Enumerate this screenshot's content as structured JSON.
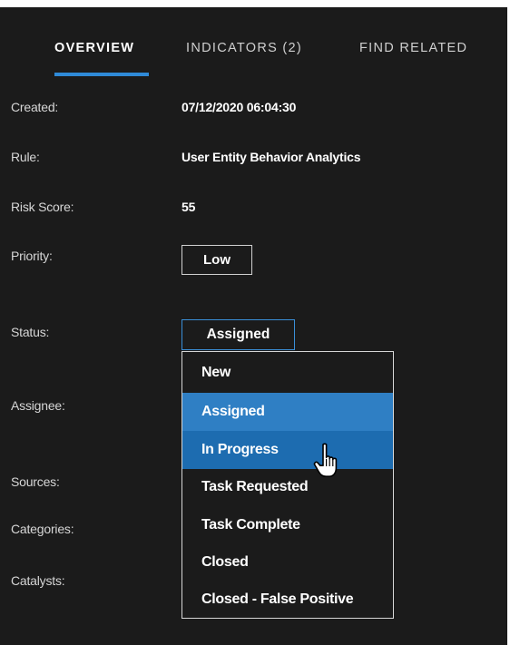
{
  "tabs": [
    {
      "label": "OVERVIEW",
      "active": true
    },
    {
      "label": "INDICATORS (2)",
      "active": false
    },
    {
      "label": "FIND RELATED",
      "active": false
    }
  ],
  "fields": {
    "created": {
      "label": "Created:",
      "value": "07/12/2020 06:04:30"
    },
    "rule": {
      "label": "Rule:",
      "value": "User Entity Behavior Analytics"
    },
    "risk_score": {
      "label": "Risk Score:",
      "value": "55"
    },
    "priority": {
      "label": "Priority:",
      "value": "Low"
    },
    "status": {
      "label": "Status:",
      "value": "Assigned"
    },
    "assignee": {
      "label": "Assignee:"
    },
    "sources": {
      "label": "Sources:"
    },
    "categories": {
      "label": "Categories:"
    },
    "catalysts": {
      "label": "Catalysts:"
    }
  },
  "status_dropdown": {
    "options": [
      "New",
      "Assigned",
      "In Progress",
      "Task Requested",
      "Task Complete",
      "Closed",
      "Closed - False Positive"
    ],
    "selected": "Assigned",
    "hovered": "In Progress"
  },
  "colors": {
    "panel_bg": "#1b1b1b",
    "accent": "#2f8ad8",
    "selected_option": "#2f7fc4",
    "hovered_option": "#1d6cb0"
  },
  "icons": {
    "cursor": "hand-pointer-icon"
  }
}
